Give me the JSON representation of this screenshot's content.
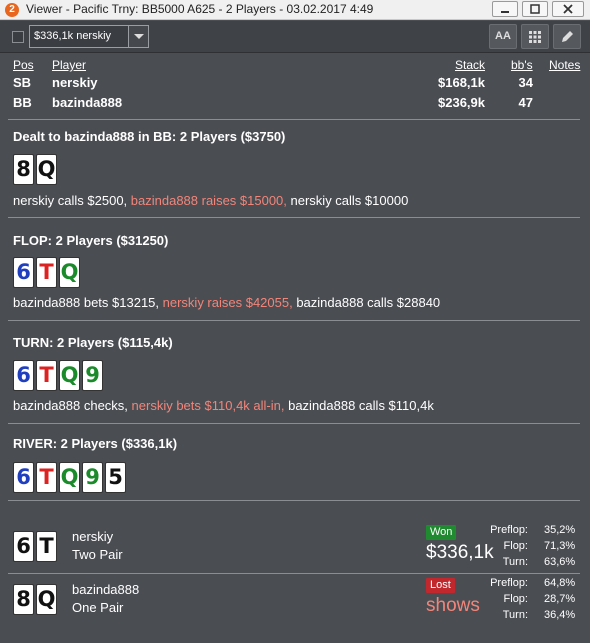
{
  "window": {
    "app_icon": "2",
    "title": "Viewer - Pacific Trny: BB5000 A625 - 2 Players - 03.02.2017 4:49",
    "minimize_icon": "minimize-icon",
    "maximize_icon": "maximize-icon",
    "close_icon": "close-icon"
  },
  "toolbar": {
    "hand_select_value": "$336,1k nerskiy",
    "font_button_label": "AA",
    "grid_icon": "grid-icon",
    "edit_icon": "pencil-icon"
  },
  "players_table": {
    "headers": {
      "pos": "Pos",
      "player": "Player",
      "stack": "Stack",
      "bbs": "bb's",
      "notes": "Notes"
    },
    "rows": [
      {
        "pos": "SB",
        "player": "nerskiy",
        "stack": "$168,1k",
        "bbs": "34"
      },
      {
        "pos": "BB",
        "player": "bazinda888",
        "stack": "$236,9k",
        "bbs": "47"
      }
    ]
  },
  "streets": {
    "preflop": {
      "title": "Dealt to bazinda888 in BB: 2 Players ($3750)",
      "cards": [
        "8",
        "Q"
      ],
      "actions": [
        {
          "text": "nerskiy calls $2500, ",
          "highlight": false
        },
        {
          "text": "bazinda888 raises $15000, ",
          "highlight": true
        },
        {
          "text": "nerskiy calls $10000",
          "highlight": false
        }
      ]
    },
    "flop": {
      "title": "FLOP: 2 Players ($31250)",
      "cards": [
        "6",
        "T",
        "Q"
      ],
      "actions": [
        {
          "text": "bazinda888 bets $13215, ",
          "highlight": false
        },
        {
          "text": "nerskiy raises $42055, ",
          "highlight": true
        },
        {
          "text": "bazinda888 calls $28840",
          "highlight": false
        }
      ]
    },
    "turn": {
      "title": "TURN: 2 Players ($115,4k)",
      "cards": [
        "6",
        "T",
        "Q",
        "9"
      ],
      "actions": [
        {
          "text": "bazinda888 checks, ",
          "highlight": false
        },
        {
          "text": "nerskiy bets $110,4k all-in, ",
          "highlight": true
        },
        {
          "text": "bazinda888 calls $110,4k",
          "highlight": false
        }
      ]
    },
    "river": {
      "title": "RIVER: 2 Players ($336,1k)",
      "cards": [
        "6",
        "T",
        "Q",
        "9",
        "5"
      ]
    }
  },
  "showdown": [
    {
      "cards": [
        "6",
        "T"
      ],
      "player": "nerskiy",
      "hand": "Two Pair",
      "result": "Won",
      "amount": "$336,1k",
      "equity": {
        "preflop_label": "Preflop:",
        "preflop": "35,2%",
        "flop_label": "Flop:",
        "flop": "71,3%",
        "turn_label": "Turn:",
        "turn": "63,6%"
      }
    },
    {
      "cards": [
        "8",
        "Q"
      ],
      "player": "bazinda888",
      "hand": "One Pair",
      "result": "Lost",
      "amount": "shows",
      "equity": {
        "preflop_label": "Preflop:",
        "preflop": "64,8%",
        "flop_label": "Flop:",
        "flop": "28,7%",
        "turn_label": "Turn:",
        "turn": "36,4%"
      }
    }
  ],
  "colors": {
    "background": "#4a4d52",
    "action_highlight": "#f2857a",
    "won_badge": "#1f8a2f",
    "lost_badge": "#c0282e",
    "card_blue": "#1f3fbf",
    "card_green": "#1a8a2a"
  }
}
